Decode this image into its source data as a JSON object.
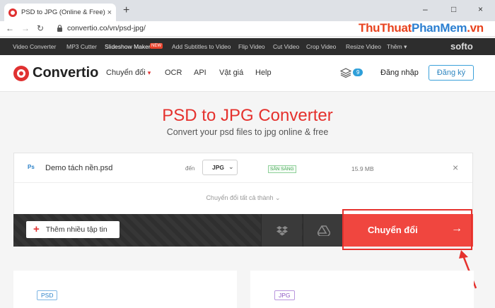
{
  "browser": {
    "tab_title": "PSD to JPG (Online & Free) — Co",
    "tab_close": "×",
    "new_tab": "+",
    "url": "convertio.co/vn/psd-jpg/",
    "controls": [
      "–",
      "□",
      "×"
    ]
  },
  "watermark": {
    "part1": "ThuThuat",
    "part2": "PhanMem",
    "part3": ".vn"
  },
  "subnav": {
    "items": [
      "Video Converter",
      "MP3 Cutter",
      "Slideshow Maker",
      "Add Subtitles to Video",
      "Flip Video",
      "Cut Video",
      "Crop Video",
      "Resize Video",
      "Thêm"
    ],
    "new_badge": "NEW",
    "brand": "softo"
  },
  "header": {
    "logo": "Convertio",
    "menu": [
      "Chuyển đổi",
      "OCR",
      "API",
      "Vật giá",
      "Help"
    ],
    "files_count": "9",
    "login": "Đăng nhập",
    "signup": "Đăng ký"
  },
  "hero": {
    "title": "PSD to JPG Converter",
    "subtitle": "Convert your psd files to jpg online & free"
  },
  "file": {
    "icon_label": "Ps",
    "name": "Demo tách nền.psd",
    "to_label": "đến",
    "format": "JPG",
    "status": "SẴN SÀNG",
    "size": "15.9 MB",
    "remove": "×"
  },
  "convert_all": "Chuyển đổi tất cả thành",
  "actions": {
    "add_files": "Thêm nhiều tập tin",
    "convert": "Chuyển đổi",
    "arrow": "→"
  },
  "panels": {
    "left_chip": "PSD",
    "right_chip": "JPG"
  },
  "colors": {
    "brand_red": "#e5312d",
    "accent_blue": "#2e9fd9",
    "ready_green": "#3aa34b"
  }
}
